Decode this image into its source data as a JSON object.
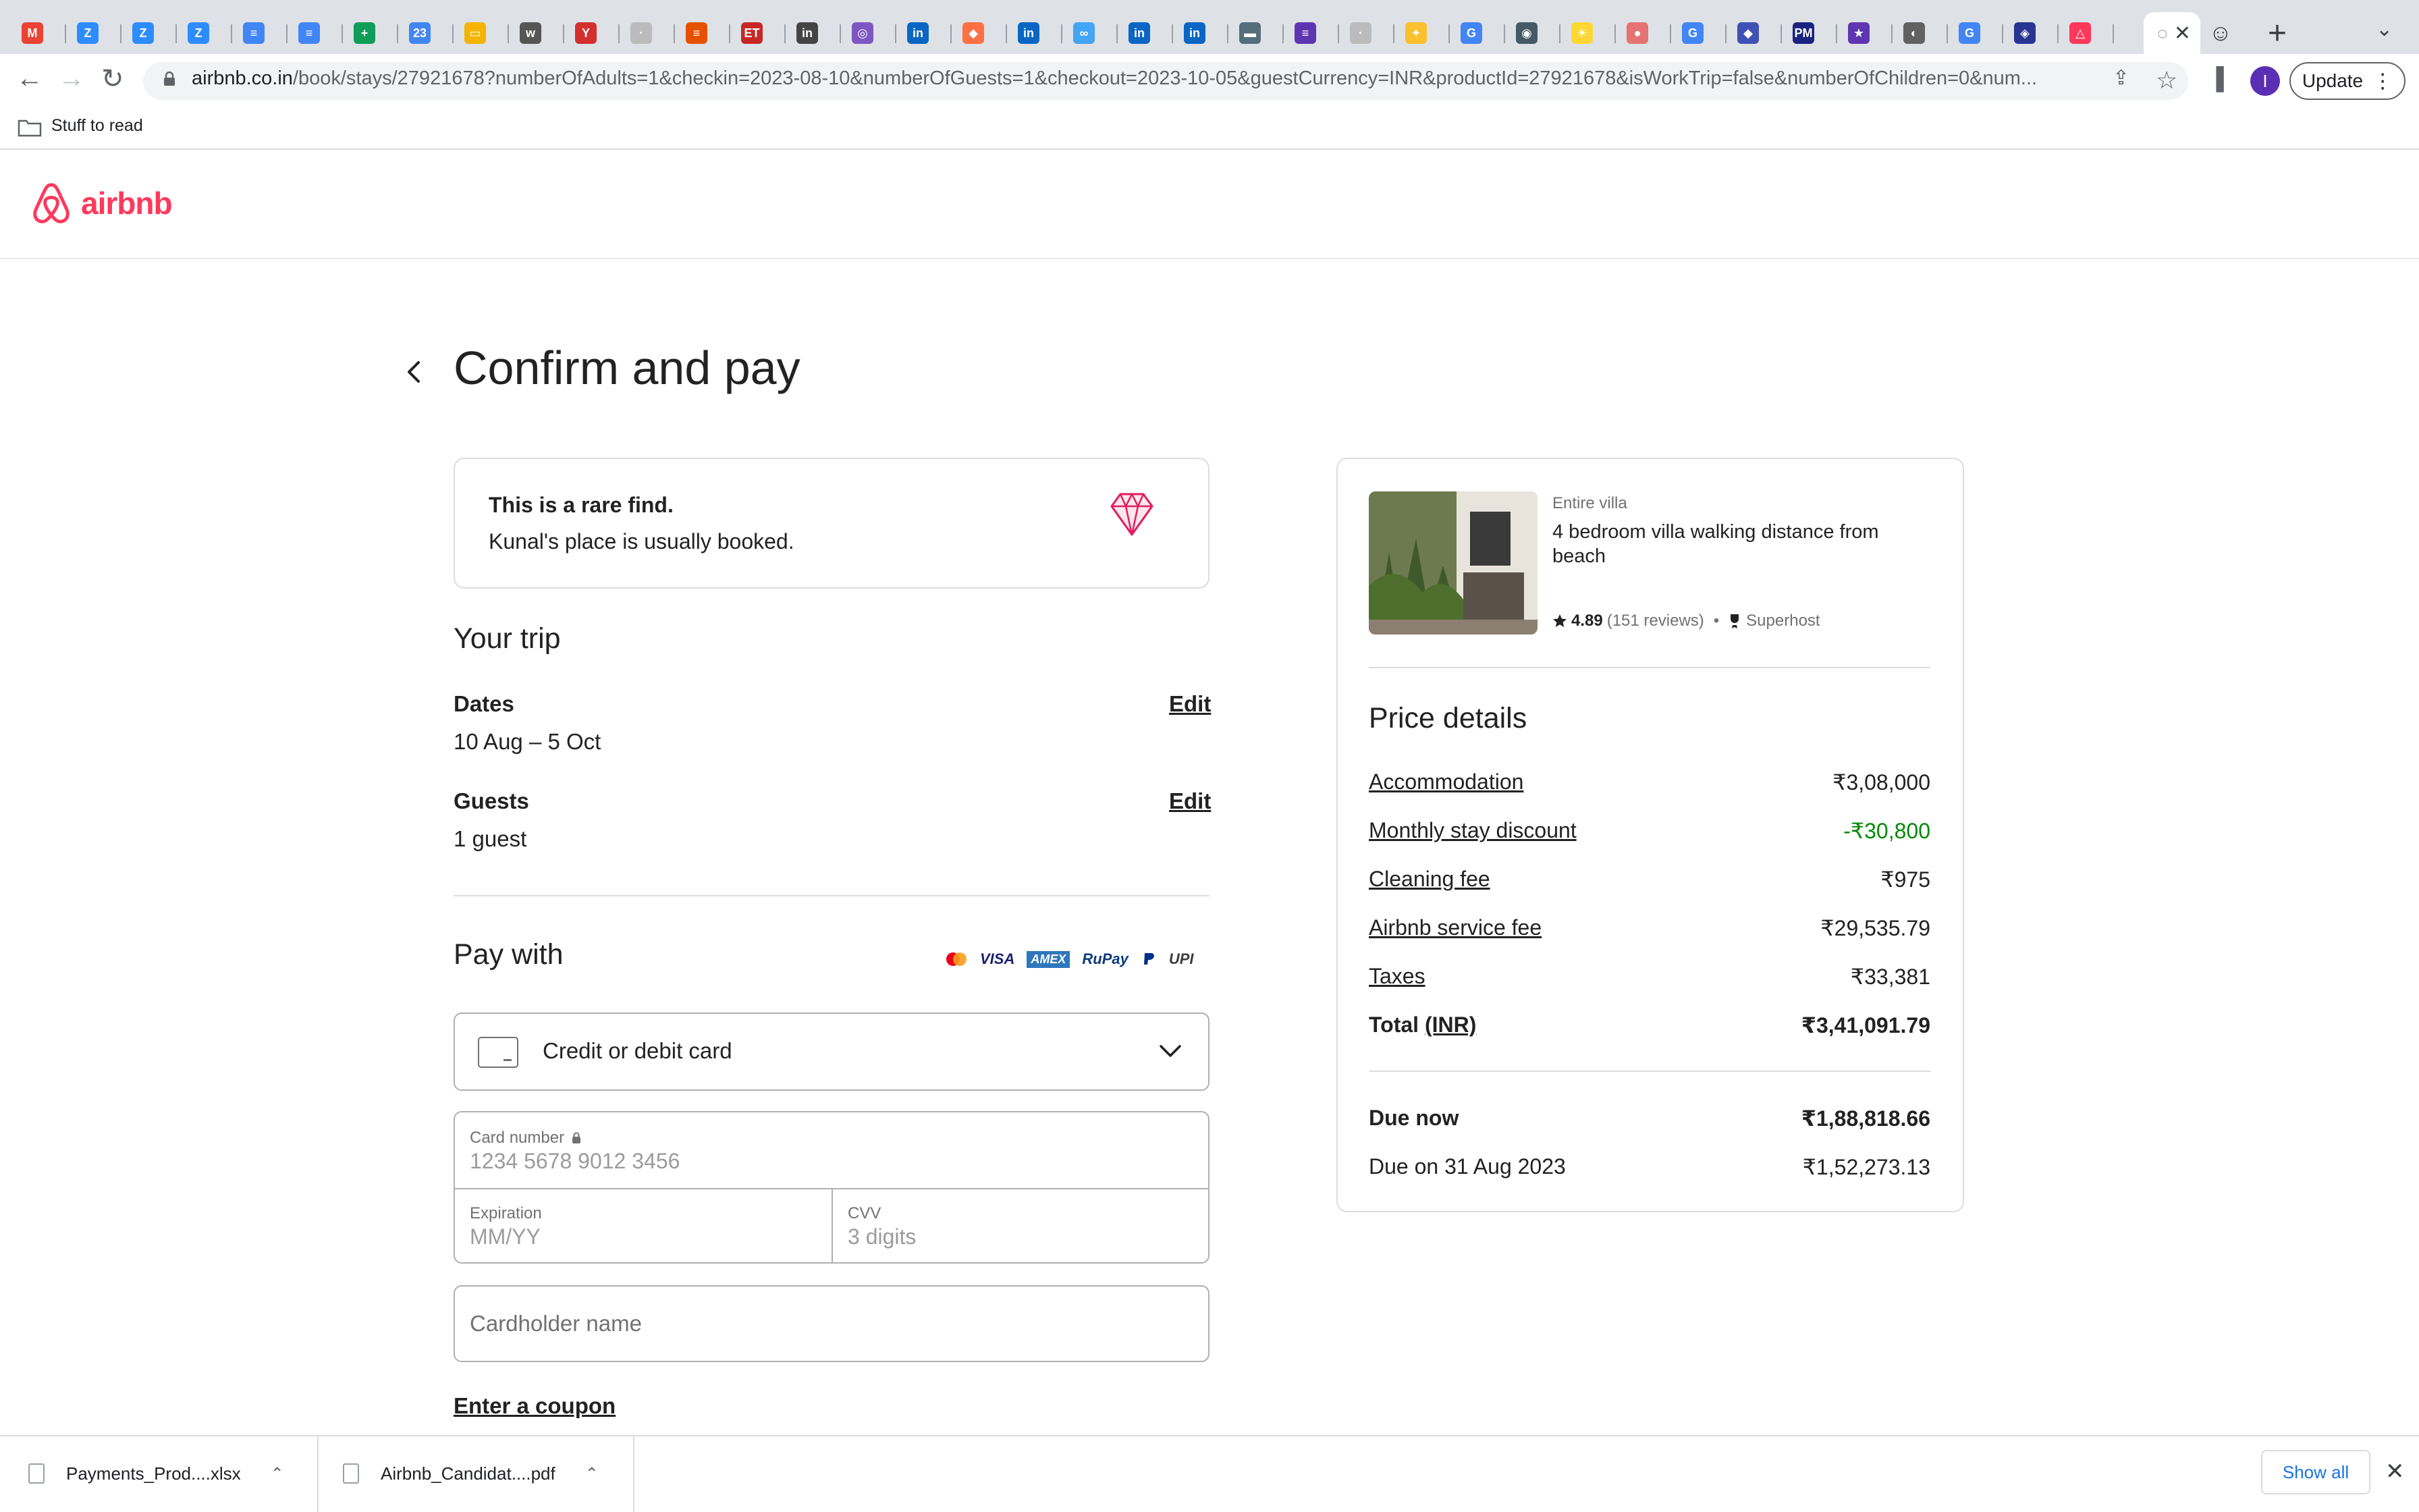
{
  "browser": {
    "url_host": "airbnb.co.in",
    "url_rest": "/book/stays/27921678?numberOfAdults=1&checkin=2023-08-10&numberOfGuests=1&checkout=2023-10-05&guestCurrency=INR&productId=27921678&isWorkTrip=false&numberOfChildren=0&num...",
    "update_label": "Update",
    "profile_initial": "I",
    "bookmark_folder": "Stuff to read",
    "tabs": [
      {
        "glyph": "M",
        "color": "#ea4335"
      },
      {
        "glyph": "Z",
        "color": "#2d8cff"
      },
      {
        "glyph": "Z",
        "color": "#2d8cff"
      },
      {
        "glyph": "Z",
        "color": "#2d8cff"
      },
      {
        "glyph": "≡",
        "color": "#4285f4"
      },
      {
        "glyph": "≡",
        "color": "#4285f4"
      },
      {
        "glyph": "+",
        "color": "#0f9d58"
      },
      {
        "glyph": "23",
        "color": "#4285f4"
      },
      {
        "glyph": "▭",
        "color": "#f4b400"
      },
      {
        "glyph": "w",
        "color": "#555555"
      },
      {
        "glyph": "Y",
        "color": "#d32f2f"
      },
      {
        "glyph": "·",
        "color": "#bbbbbb"
      },
      {
        "glyph": "≡",
        "color": "#e65100"
      },
      {
        "glyph": "ET",
        "color": "#c62828"
      },
      {
        "glyph": "in",
        "color": "#444444"
      },
      {
        "glyph": "◎",
        "color": "#7e57c2"
      },
      {
        "glyph": "in",
        "color": "#0a66c2"
      },
      {
        "glyph": "◆",
        "color": "#ff7043"
      },
      {
        "glyph": "in",
        "color": "#0a66c2"
      },
      {
        "glyph": "∞",
        "color": "#42a5f5"
      },
      {
        "glyph": "in",
        "color": "#0a66c2"
      },
      {
        "glyph": "in",
        "color": "#0a66c2"
      },
      {
        "glyph": "▬",
        "color": "#546e7a"
      },
      {
        "glyph": "≡",
        "color": "#5e35b1"
      },
      {
        "glyph": "·",
        "color": "#bbbbbb"
      },
      {
        "glyph": "✦",
        "color": "#fbc02d"
      },
      {
        "glyph": "G",
        "color": "#4285f4"
      },
      {
        "glyph": "◉",
        "color": "#455a64"
      },
      {
        "glyph": "☀",
        "color": "#fdd835"
      },
      {
        "glyph": "●",
        "color": "#e57373"
      },
      {
        "glyph": "G",
        "color": "#4285f4"
      },
      {
        "glyph": "◆",
        "color": "#3f51b5"
      },
      {
        "glyph": "PM",
        "color": "#1a237e"
      },
      {
        "glyph": "★",
        "color": "#5e35b1"
      },
      {
        "glyph": "◐",
        "color": "#616161"
      },
      {
        "glyph": "G",
        "color": "#4285f4"
      },
      {
        "glyph": "◈",
        "color": "#283593"
      },
      {
        "glyph": "△",
        "color": "#ff385c"
      }
    ]
  },
  "site": {
    "logo_text": "airbnb",
    "brand_color": "#ff385c"
  },
  "page": {
    "title": "Confirm and pay"
  },
  "rare_find": {
    "title": "This is a rare find.",
    "subtitle": "Kunal's place is usually booked.",
    "icon": "diamond-icon"
  },
  "trip": {
    "heading": "Your trip",
    "dates_label": "Dates",
    "dates_value": "10 Aug – 5 Oct",
    "guests_label": "Guests",
    "guests_value": "1 guest",
    "edit_label": "Edit"
  },
  "payment": {
    "heading": "Pay with",
    "brands": [
      "VISA",
      "AMEX",
      "RuPay",
      "UPI"
    ],
    "method_selected": "Credit or debit card",
    "card_number_label": "Card number",
    "card_number_placeholder": "1234 5678 9012 3456",
    "expiration_label": "Expiration",
    "expiration_placeholder": "MM/YY",
    "cvv_label": "CVV",
    "cvv_placeholder": "3 digits",
    "cardholder_placeholder": "Cardholder name",
    "coupon_label": "Enter a coupon"
  },
  "listing": {
    "type": "Entire villa",
    "title": "4 bedroom villa walking distance from beach",
    "rating": "4.89",
    "reviews": "(151 reviews)",
    "bullet": "•",
    "host_badge": "Superhost"
  },
  "price_details": {
    "heading": "Price details",
    "rows": [
      {
        "label": "Accommodation",
        "value": "₹3,08,000"
      },
      {
        "label": "Monthly stay discount",
        "value": "-₹30,800"
      },
      {
        "label": "Cleaning fee",
        "value": "₹975"
      },
      {
        "label": "Airbnb service fee",
        "value": "₹29,535.79"
      },
      {
        "label": "Taxes",
        "value": "₹33,381"
      }
    ],
    "total_label": "Total",
    "total_currency": "(INR)",
    "total_value": "₹3,41,091.79",
    "due_now_label": "Due now",
    "due_now_value": "₹1,88,818.66",
    "due_later_label": "Due on 31 Aug 2023",
    "due_later_value": "₹1,52,273.13",
    "discount_color": "#008a05"
  },
  "downloads": {
    "items": [
      {
        "name": "Payments_Prod....xlsx"
      },
      {
        "name": "Airbnb_Candidat....pdf"
      }
    ],
    "show_all": "Show all"
  }
}
